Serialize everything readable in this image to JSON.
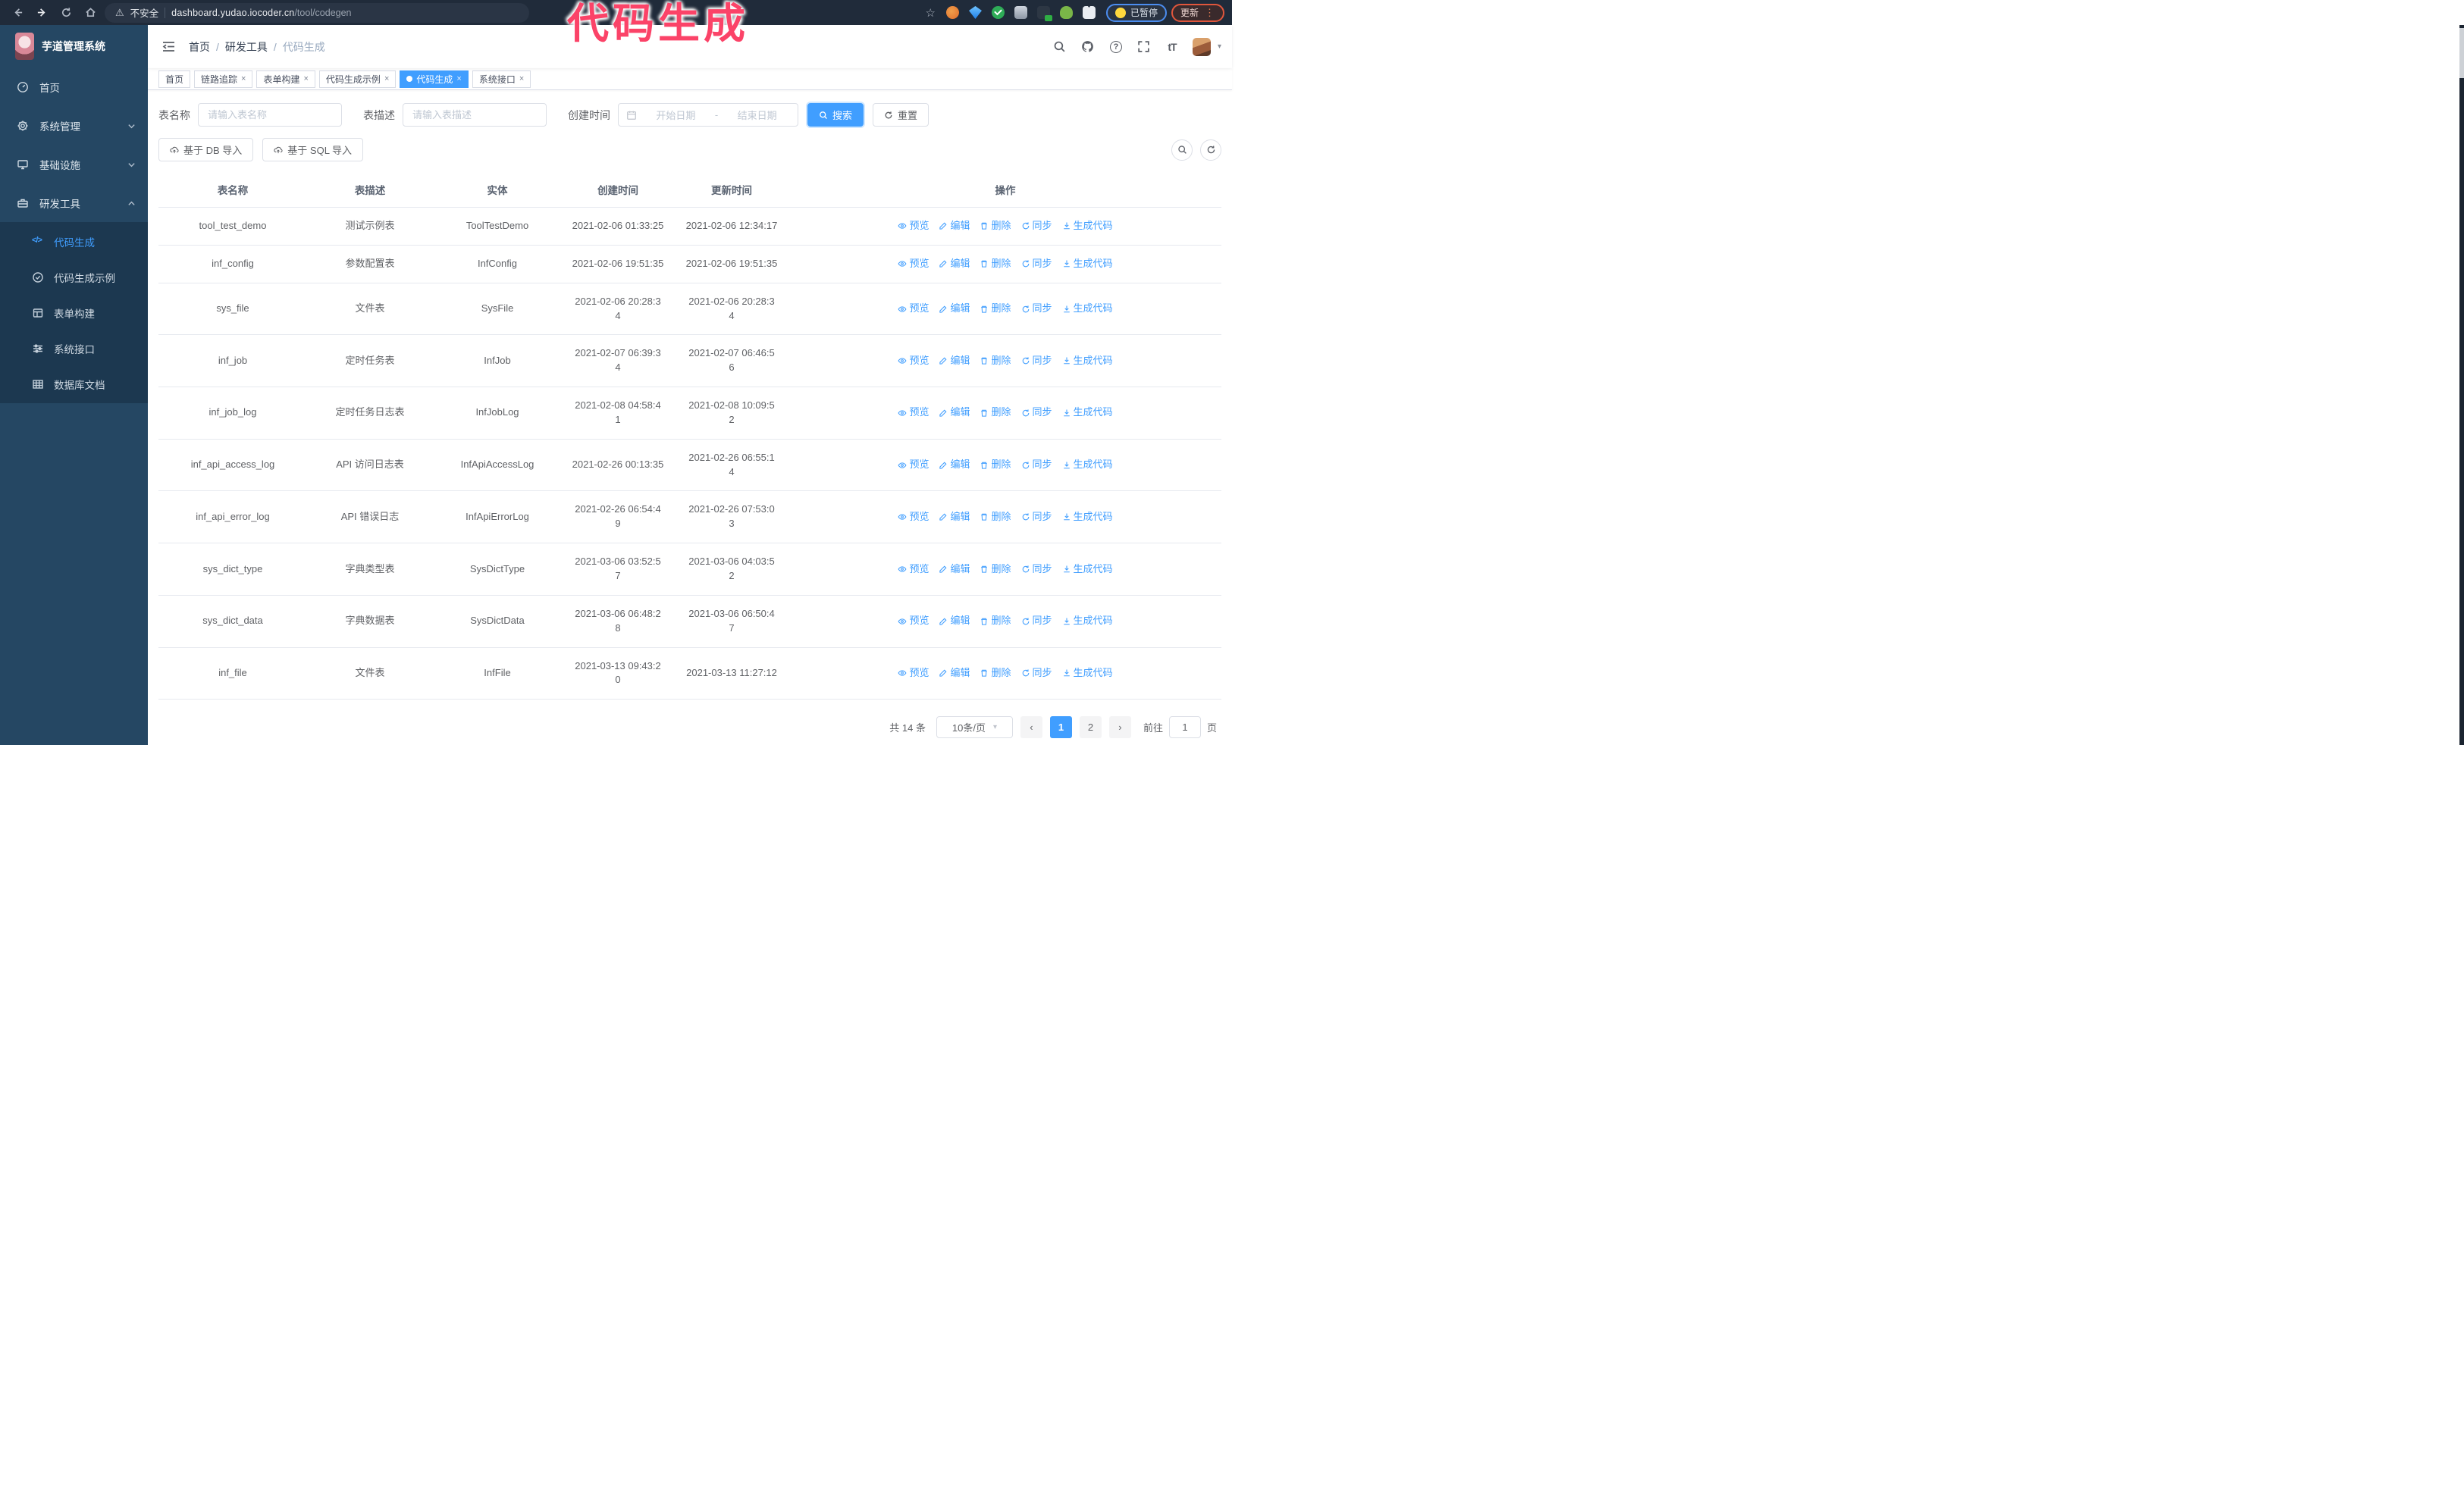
{
  "browser": {
    "security_label": "不安全",
    "url_host": "dashboard.yudao.iocoder.cn",
    "url_path": "/tool/codegen",
    "paused_badge": "已暂停",
    "update_button": "更新"
  },
  "overlay_note": {
    "text": "代码生成"
  },
  "glyphs": {
    "close": "×",
    "caret_down": "▾",
    "slash": "/",
    "font_size": "tT",
    "star": "☆",
    "warning": "⚠",
    "more": "⋮",
    "question": "?",
    "code": "</>",
    "prev": "‹",
    "next": "›"
  },
  "sidebar": {
    "app_title": "芋道管理系统",
    "items": [
      {
        "label": "首页"
      },
      {
        "label": "系统管理"
      },
      {
        "label": "基础设施"
      },
      {
        "label": "研发工具"
      }
    ],
    "submenu": [
      {
        "label": "代码生成"
      },
      {
        "label": "代码生成示例"
      },
      {
        "label": "表单构建"
      },
      {
        "label": "系统接口"
      },
      {
        "label": "数据库文档"
      }
    ]
  },
  "breadcrumb": [
    "首页",
    "研发工具",
    "代码生成"
  ],
  "tabs": [
    {
      "label": "首页"
    },
    {
      "label": "链路追踪"
    },
    {
      "label": "表单构建"
    },
    {
      "label": "代码生成示例"
    },
    {
      "label": "代码生成"
    },
    {
      "label": "系统接口"
    }
  ],
  "filters": {
    "name_label": "表名称",
    "name_placeholder": "请输入表名称",
    "desc_label": "表描述",
    "desc_placeholder": "请输入表描述",
    "time_label": "创建时间",
    "start_placeholder": "开始日期",
    "range_separator": "-",
    "end_placeholder": "结束日期",
    "search_label": "搜索",
    "reset_label": "重置"
  },
  "toolbar": {
    "import_db": "基于 DB 导入",
    "import_sql": "基于 SQL 导入"
  },
  "table": {
    "columns": [
      "表名称",
      "表描述",
      "实体",
      "创建时间",
      "更新时间",
      "操作"
    ],
    "actions": [
      "预览",
      "编辑",
      "删除",
      "同步",
      "生成代码"
    ],
    "rows": [
      {
        "name": "tool_test_demo",
        "desc": "测试示例表",
        "entity": "ToolTestDemo",
        "created": "2021-02-06 01:33:25",
        "updated": "2021-02-06 12:34:17"
      },
      {
        "name": "inf_config",
        "desc": "参数配置表",
        "entity": "InfConfig",
        "created": "2021-02-06 19:51:35",
        "updated": "2021-02-06 19:51:35"
      },
      {
        "name": "sys_file",
        "desc": "文件表",
        "entity": "SysFile",
        "created": "2021-02-06 20:28:3\n4",
        "updated": "2021-02-06 20:28:3\n4"
      },
      {
        "name": "inf_job",
        "desc": "定时任务表",
        "entity": "InfJob",
        "created": "2021-02-07 06:39:3\n4",
        "updated": "2021-02-07 06:46:5\n6"
      },
      {
        "name": "inf_job_log",
        "desc": "定时任务日志表",
        "entity": "InfJobLog",
        "created": "2021-02-08 04:58:4\n1",
        "updated": "2021-02-08 10:09:5\n2"
      },
      {
        "name": "inf_api_access_log",
        "desc": "API 访问日志表",
        "entity": "InfApiAccessLog",
        "created": "2021-02-26 00:13:35",
        "updated": "2021-02-26 06:55:1\n4"
      },
      {
        "name": "inf_api_error_log",
        "desc": "API 错误日志",
        "entity": "InfApiErrorLog",
        "created": "2021-02-26 06:54:4\n9",
        "updated": "2021-02-26 07:53:0\n3"
      },
      {
        "name": "sys_dict_type",
        "desc": "字典类型表",
        "entity": "SysDictType",
        "created": "2021-03-06 03:52:5\n7",
        "updated": "2021-03-06 04:03:5\n2"
      },
      {
        "name": "sys_dict_data",
        "desc": "字典数据表",
        "entity": "SysDictData",
        "created": "2021-03-06 06:48:2\n8",
        "updated": "2021-03-06 06:50:4\n7"
      },
      {
        "name": "inf_file",
        "desc": "文件表",
        "entity": "InfFile",
        "created": "2021-03-13 09:43:2\n0",
        "updated": "2021-03-13 11:27:12"
      }
    ]
  },
  "pagination": {
    "total": "共 14 条",
    "page_size": "10条/页",
    "page1": "1",
    "page2": "2",
    "goto_label": "前往",
    "goto_value": "1",
    "unit": "页"
  }
}
